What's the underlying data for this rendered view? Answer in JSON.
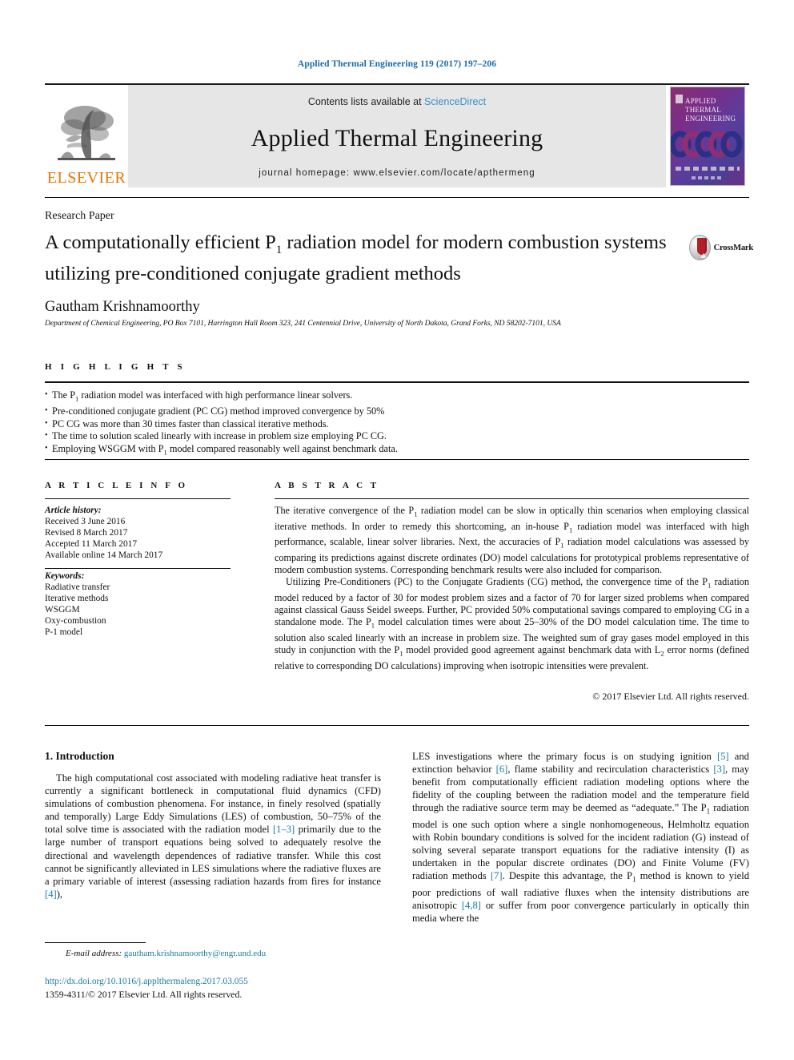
{
  "running_head": "Applied Thermal Engineering 119 (2017) 197–206",
  "masthead": {
    "publisher_logo_text": "ELSEVIER",
    "contents_prefix": "Contents lists available at ",
    "sciencedirect": "ScienceDirect",
    "journal_title": "Applied Thermal Engineering",
    "homepage": "journal homepage: www.elsevier.com/locate/apthermeng",
    "cover_title_lines": [
      "APPLIED",
      "THERMAL",
      "ENGINEERING"
    ]
  },
  "article": {
    "kind": "Research Paper",
    "title_line1_a": "A computationally efficient P",
    "title_line1_sub": "1",
    "title_line1_b": " radiation model for modern combustion",
    "title_line2": "systems utilizing pre-conditioned conjugate gradient methods",
    "crossmark_label": "CrossMark",
    "author": "Gautham Krishnamoorthy",
    "affiliation": "Department of Chemical Engineering, PO Box 7101, Harrington Hall Room 323, 241 Centennial Drive, University of North Dakota, Grand Forks, ND 58202-7101, USA"
  },
  "highlights": {
    "label": "H I G H L I G H T S",
    "items": [
      {
        "pre": "The P",
        "sub": "1",
        "post": " radiation model was interfaced with high performance linear solvers."
      },
      {
        "pre": "Pre-conditioned conjugate gradient (PC CG) method improved convergence by 50%",
        "sub": "",
        "post": ""
      },
      {
        "pre": "PC CG was more than 30 times faster than classical iterative methods.",
        "sub": "",
        "post": ""
      },
      {
        "pre": "The time to solution scaled linearly with increase in problem size employing PC CG.",
        "sub": "",
        "post": ""
      },
      {
        "pre": "Employing WSGGM with P",
        "sub": "1",
        "post": " model compared reasonably well against benchmark data."
      }
    ]
  },
  "article_info": {
    "label": "A R T I C L E  I N F O",
    "history_heading": "Article history:",
    "history": [
      "Received 3 June 2016",
      "Revised 8 March 2017",
      "Accepted 11 March 2017",
      "Available online 14 March 2017"
    ],
    "keywords_heading": "Keywords:",
    "keywords": [
      "Radiative transfer",
      "Iterative methods",
      "WSGGM",
      "Oxy-combustion",
      "P-1 model"
    ]
  },
  "abstract": {
    "label": "A B S T R A C T",
    "p1_a": "The iterative convergence of the P",
    "p1_sub1": "1",
    "p1_b": " radiation model can be slow in optically thin scenarios when employing classical iterative methods. In order to remedy this shortcoming, an in-house P",
    "p1_sub2": "1",
    "p1_c": " radiation model was interfaced with high performance, scalable, linear solver libraries. Next, the accuracies of P",
    "p1_sub3": "1",
    "p1_d": " radiation model calculations was assessed by comparing its predictions against discrete ordinates (DO) model calculations for prototypical problems representative of modern combustion systems. Corresponding benchmark results were also included for comparison.",
    "p2_a": "Utilizing Pre-Conditioners (PC) to the Conjugate Gradients (CG) method, the convergence time of the P",
    "p2_sub1": "1",
    "p2_b": " radiation model reduced by a factor of 30 for modest problem sizes and a factor of 70 for larger sized problems when compared against classical Gauss Seidel sweeps. Further, PC provided 50% computational savings compared to employing CG in a standalone mode. The P",
    "p2_sub2": "1",
    "p2_c": " model calculation times were about 25–30% of the DO model calculation time. The time to solution also scaled linearly with an increase in problem size. The weighted sum of gray gases model employed in this study in conjunction with the P",
    "p2_sub3": "1",
    "p2_d": " model provided good agreement against benchmark data with L",
    "p2_sub4": "2",
    "p2_e": " error norms (defined relative to corresponding DO calculations) improving when isotropic intensities were prevalent.",
    "copyright": "© 2017 Elsevier Ltd. All rights reserved."
  },
  "introduction": {
    "heading": "1. Introduction",
    "left_a": "The high computational cost associated with modeling radiative heat transfer is currently a significant bottleneck in computational fluid dynamics (CFD) simulations of combustion phenomena. For instance, in finely resolved (spatially and temporally) Large Eddy Simulations (LES) of combustion, 50–75% of the total solve time is associated with the radiation model ",
    "ref1": "[1–3]",
    "left_b": " primarily due to the large number of transport equations being solved to adequately resolve the directional and wavelength dependences of radiative transfer. While this cost cannot be significantly alleviated in LES simulations where the radiative fluxes are a primary variable of interest (assessing radiation hazards from fires for instance ",
    "ref2": "[4]",
    "left_c": "),",
    "right_a": "LES investigations where the primary focus is on studying ignition ",
    "ref3": "[5]",
    "right_b": " and extinction behavior ",
    "ref4": "[6]",
    "right_c": ", flame stability and recirculation characteristics ",
    "ref5": "[3]",
    "right_d": ", may benefit from computationally efficient radiation modeling options where the fidelity of the coupling between the radiation model and the temperature field through the radiative source term may be deemed as “adequate.” The P",
    "right_sub1": "1",
    "right_e": " radiation model is one such option where a single nonhomogeneous, Helmholtz equation with Robin boundary conditions is solved for the incident radiation (G) instead of solving several separate transport equations for the radiative intensity (I) as undertaken in the popular discrete ordinates (DO) and Finite Volume (FV) radiation methods ",
    "ref6": "[7]",
    "right_f": ". Despite this advantage, the P",
    "right_sub2": "1",
    "right_g": " method is known to yield poor predictions of wall radiative fluxes when the intensity distributions are anisotropic ",
    "ref7": "[4,8]",
    "right_h": " or suffer from poor convergence particularly in optically thin media where the"
  },
  "footer": {
    "email_label": "E-mail address:",
    "email": "gautham.krishnamoorthy@engr.und.edu",
    "doi": "http://dx.doi.org/10.1016/j.applthermaleng.2017.03.055",
    "issn": "1359-4311/© 2017 Elsevier Ltd. All rights reserved."
  },
  "colors": {
    "link": "#1b7ba8",
    "running_head": "#1b6ca8",
    "elsevier_orange": "#ea7600",
    "band_gray": "#e6e6e6"
  }
}
